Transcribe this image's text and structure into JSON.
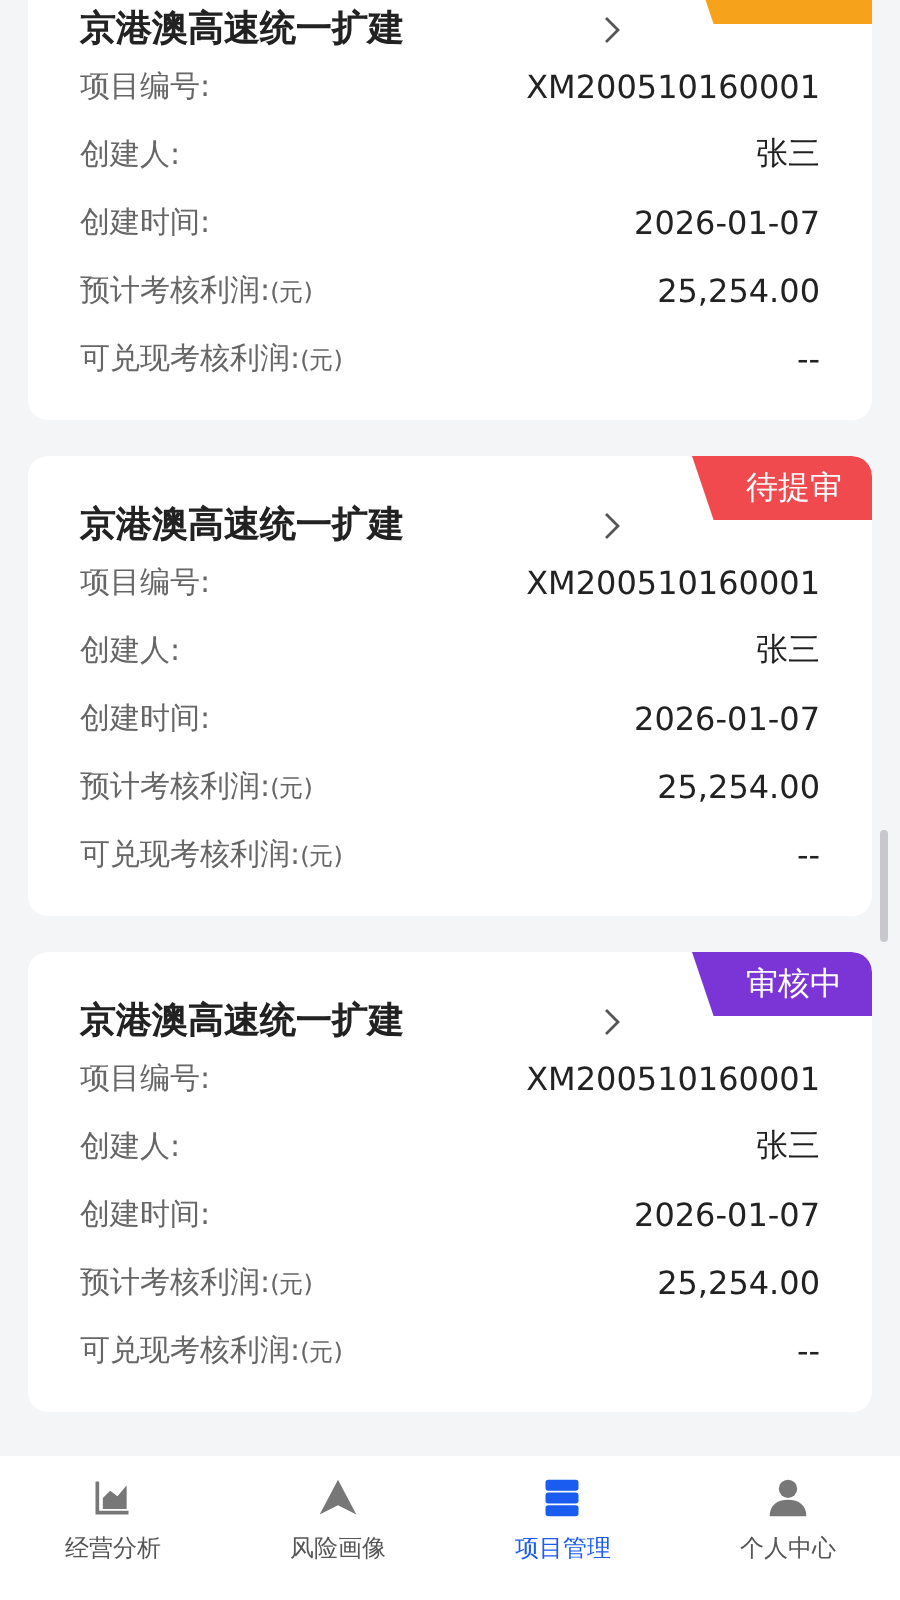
{
  "projects": [
    {
      "title": "京港澳高速统一扩建",
      "status": {
        "color": "#f7a21b"
      },
      "fields": [
        {
          "label": "项目编号:",
          "value": "XM200510160001"
        },
        {
          "label": "创建人:",
          "value": "张三"
        },
        {
          "label": "创建时间:",
          "value": "2026-01-07"
        },
        {
          "label": "预计考核利润:",
          "unit": "(元)",
          "value": "25,254.00"
        },
        {
          "label": "可兑现考核利润:",
          "unit": "(元)",
          "value": "--"
        }
      ]
    },
    {
      "title": "京港澳高速统一扩建",
      "status": {
        "label": "待提审",
        "color": "#f04a4f"
      },
      "fields": [
        {
          "label": "项目编号:",
          "value": "XM200510160001"
        },
        {
          "label": "创建人:",
          "value": "张三"
        },
        {
          "label": "创建时间:",
          "value": "2026-01-07"
        },
        {
          "label": "预计考核利润:",
          "unit": "(元)",
          "value": "25,254.00"
        },
        {
          "label": "可兑现考核利润:",
          "unit": "(元)",
          "value": "--"
        }
      ]
    },
    {
      "title": "京港澳高速统一扩建",
      "status": {
        "label": "审核中",
        "color": "#7b35d6"
      },
      "fields": [
        {
          "label": "项目编号:",
          "value": "XM200510160001"
        },
        {
          "label": "创建人:",
          "value": "张三"
        },
        {
          "label": "创建时间:",
          "value": "2026-01-07"
        },
        {
          "label": "预计考核利润:",
          "unit": "(元)",
          "value": "25,254.00"
        },
        {
          "label": "可兑现考核利润:",
          "unit": "(元)",
          "value": "--"
        }
      ]
    }
  ],
  "tabbar": [
    {
      "kind": "chart",
      "label": "经营分析",
      "selected": false
    },
    {
      "kind": "triangle",
      "label": "风险画像",
      "selected": false
    },
    {
      "kind": "stack",
      "label": "项目管理",
      "selected": true
    },
    {
      "kind": "person",
      "label": "个人中心",
      "selected": false
    }
  ]
}
